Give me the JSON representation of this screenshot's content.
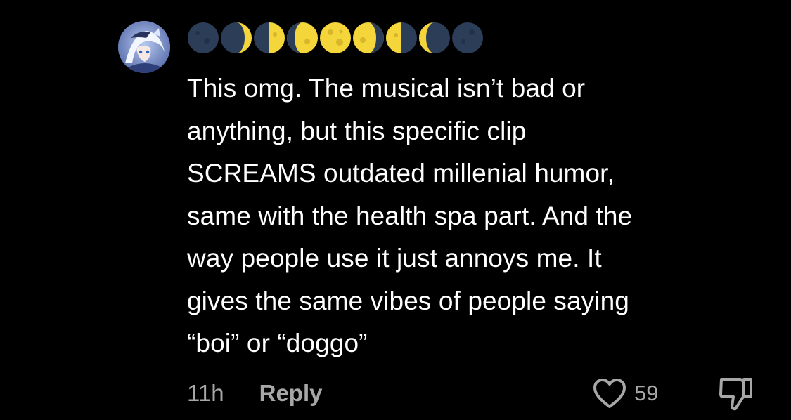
{
  "comment": {
    "username_icons": [
      "new-moon-icon",
      "waxing-crescent-moon-icon",
      "first-quarter-moon-icon",
      "waxing-gibbous-moon-icon",
      "full-moon-icon",
      "waning-gibbous-moon-icon",
      "last-quarter-moon-icon",
      "waning-crescent-moon-icon",
      "new-moon-icon"
    ],
    "text": "This omg. The musical isn’t bad or\nanything, but this specific clip\nSCREAMS outdated millenial humor,\nsame with the health spa part. And the\nway people use it just annoys me. It\ngives the same vibes of people saying\n“boi” or “doggo”",
    "timestamp": "11h",
    "reply_label": "Reply",
    "like_count": "59"
  },
  "colors": {
    "background": "#000000",
    "text": "#ffffff",
    "secondary_text": "#a7a7a7",
    "moon_dark": "#2c3d57",
    "moon_light": "#f4d53a"
  }
}
